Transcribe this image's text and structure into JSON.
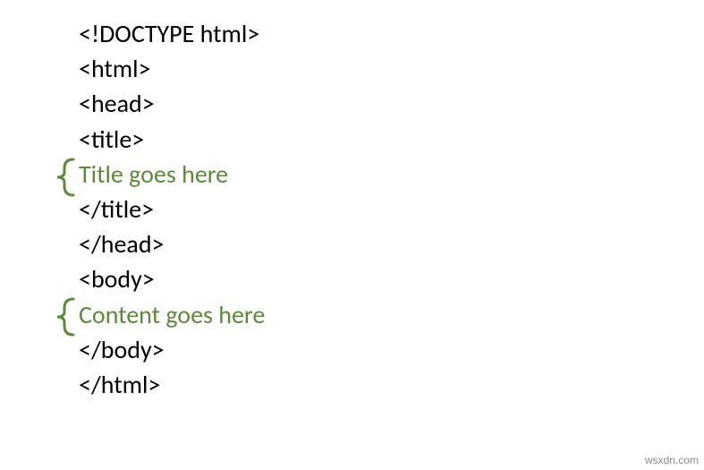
{
  "code": {
    "line1": "<!DOCTYPE html>",
    "line2": "<html>",
    "line3": "<head>",
    "line4": "<title>",
    "line5": "Title goes here",
    "line6": "</title>",
    "line7": "</head>",
    "line8": "<body>",
    "line9": "Content goes here",
    "line10": "</body>",
    "line11": "</html>"
  },
  "watermark": "wsxdn.com",
  "colors": {
    "placeholder": "#5a8a3a",
    "text": "#000000",
    "bracket": "#5a8a3a"
  }
}
